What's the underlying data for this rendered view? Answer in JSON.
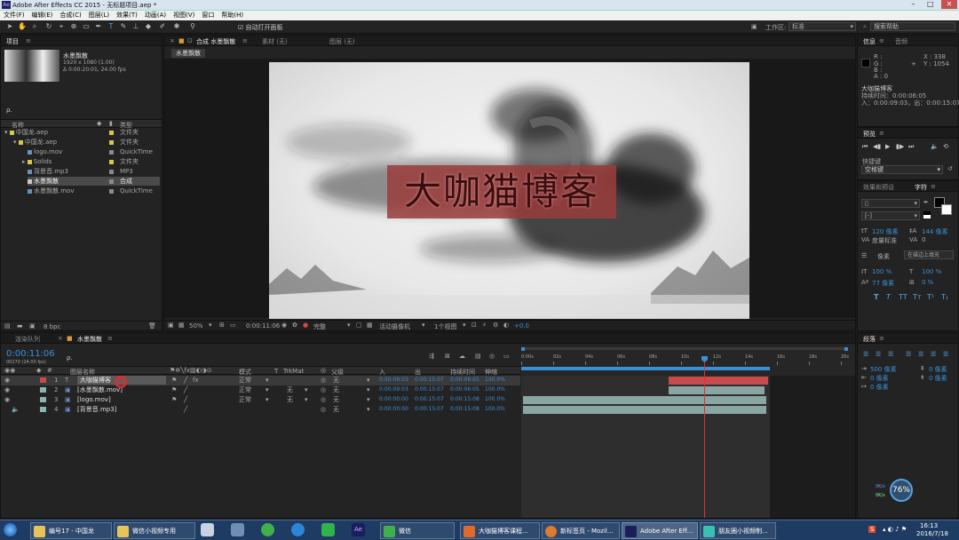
{
  "window": {
    "title": "Adobe After Effects CC 2015 - 无标题项目.aep *",
    "app_icon": "Ae"
  },
  "menu": [
    "文件(F)",
    "编辑(E)",
    "合成(C)",
    "图层(L)",
    "效果(T)",
    "动画(A)",
    "视图(V)",
    "窗口",
    "帮助(H)"
  ],
  "toolbar": {
    "auto_open": "自动打开面板",
    "workspace_label": "工作区:",
    "workspace_value": "标准",
    "search_help": "搜索帮助"
  },
  "project": {
    "tab": "项目",
    "comp_name": "水墨飘散",
    "comp_info1": "1920 x 1080 (1.00)",
    "comp_info2": "Δ 0:00:20:01, 24.00 fps",
    "search_placeholder": "ρ.",
    "col_name": "名称",
    "col_type": "类型",
    "items": [
      {
        "name": "中国龙.aep",
        "type": "文件夹",
        "color": "#d8c84a"
      },
      {
        "name": "中国龙.aep",
        "type": "文件夹",
        "color": "#d8c84a"
      },
      {
        "name": "logo.mov",
        "type": "QuickTime",
        "color": "#8a8a8a"
      },
      {
        "name": "Solids",
        "type": "文件夹",
        "color": "#d8c84a"
      },
      {
        "name": "背景音.mp3",
        "type": "MP3",
        "color": "#8a8a8a"
      },
      {
        "name": "水墨飘散",
        "type": "合成",
        "color": "#8a8a8a"
      },
      {
        "name": "水墨飘散.mov",
        "type": "QuickTime",
        "color": "#8a8a8a"
      }
    ],
    "bpc": "8 bpc"
  },
  "viewer": {
    "comp_tab": "合成 水墨飘散",
    "footage_tab": "素材 (无)",
    "layer_tab": "图层 (无)",
    "breadcrumb": "水墨飘散",
    "overlay_text": "大咖猫博客",
    "zoom": "50%",
    "timecode": "0:00:11:06",
    "quality": "完整",
    "camera": "活动摄像机",
    "views": "1个视图",
    "exposure": "+0.0"
  },
  "info": {
    "tab_info": "信息",
    "tab_audio": "音频",
    "r": "R :",
    "g": "G :",
    "b": "B :",
    "a": "A : 0",
    "x": "X : 338",
    "y": "Y : 1054",
    "layer_name": "大咖猫博客",
    "duration": "持续时间：0:00:06:05",
    "in_out": "入：0:00:09:03，出：0:00:15:07"
  },
  "preview": {
    "tab": "预览",
    "shortcut_label": "快捷键",
    "shortcut_value": "空格键"
  },
  "character": {
    "tab_effects": "效果和预设",
    "tab_char": "字符",
    "size": "120 像素",
    "leading": "144 像素",
    "kerning": "度量标准",
    "tracking": "0",
    "stroke": "像素",
    "stroke_type": "在描边上填充",
    "vscale": "100 %",
    "hscale": "100 %",
    "baseline": "77 像素",
    "tsume": "0 %"
  },
  "paragraph": {
    "tab": "段落",
    "indent1": "500 像素",
    "indent2": "0 像素",
    "indent3": "0 像素",
    "space1": "0 像素",
    "space2": "0 像素"
  },
  "timeline": {
    "tab_render": "渲染队列",
    "tab_comp": "水墨飘散",
    "timecode": "0:00:11:06",
    "fps": "00270 (24.00 fps)",
    "headers": {
      "name": "图层名称",
      "mode": "模式",
      "t": "T",
      "trkmat": "TrkMat",
      "parent": "父级",
      "in": "入",
      "out": "出",
      "duration": "持续时间",
      "stretch": "伸缩"
    },
    "layers": [
      {
        "num": "1",
        "name": "大咖猫博客",
        "mode": "正常",
        "trkmat": "",
        "parent": "无",
        "in": "0:00:09:03",
        "out": "0:00:15:07",
        "dur": "0:00:06:05",
        "stretch": "100.0%",
        "color": "#c84a4a"
      },
      {
        "num": "2",
        "name": "[水墨飘散.mov]",
        "mode": "正常",
        "trkmat": "无",
        "parent": "无",
        "in": "0:00:09:03",
        "out": "0:00:15:07",
        "dur": "0:00:06:05",
        "stretch": "100.0%",
        "color": "#8ab5b0"
      },
      {
        "num": "3",
        "name": "[logo.mov]",
        "mode": "正常",
        "trkmat": "无",
        "parent": "无",
        "in": "0:00:00:00",
        "out": "0:00:15:07",
        "dur": "0:00:15:08",
        "stretch": "100.0%",
        "color": "#8ab5b0"
      },
      {
        "num": "4",
        "name": "[背景音.mp3]",
        "mode": "",
        "trkmat": "",
        "parent": "无",
        "in": "0:00:00:00",
        "out": "0:00:15:07",
        "dur": "0:00:15:08",
        "stretch": "100.0%",
        "color": "#8ab5b0"
      }
    ],
    "ruler": [
      "0:00s",
      "02s",
      "04s",
      "06s",
      "08s",
      "10s",
      "12s",
      "14s",
      "16s",
      "18s",
      "20s"
    ]
  },
  "netmeter": {
    "percent": "76%",
    "up": "0K/s",
    "down": "0K/s"
  },
  "taskbar": {
    "items": [
      "编号17 - 中国龙",
      "微信小视频专用",
      "微信",
      "大咖猫博客课程...",
      "新标签页 - Mozil...",
      "Adobe After Eff...",
      "朋友圈小视频制..."
    ],
    "time": "16:13",
    "date": "2016/7/18"
  }
}
